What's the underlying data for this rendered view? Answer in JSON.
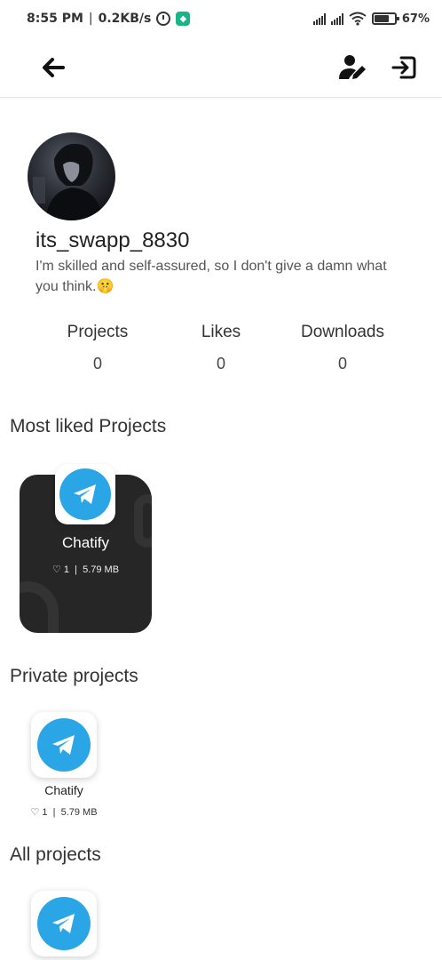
{
  "status_bar": {
    "time": "8:55 PM",
    "separator": "|",
    "speed": "0.2KB/s",
    "battery_percent": "67%",
    "battery_level": 0.67
  },
  "app_bar": {
    "back_icon": "arrow-left-icon",
    "edit_icon": "edit-user-icon",
    "logout_icon": "logout-icon"
  },
  "profile": {
    "username": "its_swapp_8830",
    "bio": "I'm skilled and self-assured, so I don't give a damn what you think.🤫"
  },
  "stats": [
    {
      "label": "Projects",
      "value": "0"
    },
    {
      "label": "Likes",
      "value": "0"
    },
    {
      "label": "Downloads",
      "value": "0"
    }
  ],
  "sections": {
    "most_liked": "Most liked Projects",
    "private": "Private projects",
    "all": "All projects"
  },
  "most_liked_projects": [
    {
      "name": "Chatify",
      "meta": "♡ 1  |  5.79 MB"
    }
  ],
  "private_projects": [
    {
      "name": "Chatify",
      "meta": "♡ 1  |  5.79 MB"
    }
  ],
  "colors": {
    "telegram_blue": "#2aa6e6",
    "card_dark": "#262626",
    "app_badge": "#18b58a"
  }
}
